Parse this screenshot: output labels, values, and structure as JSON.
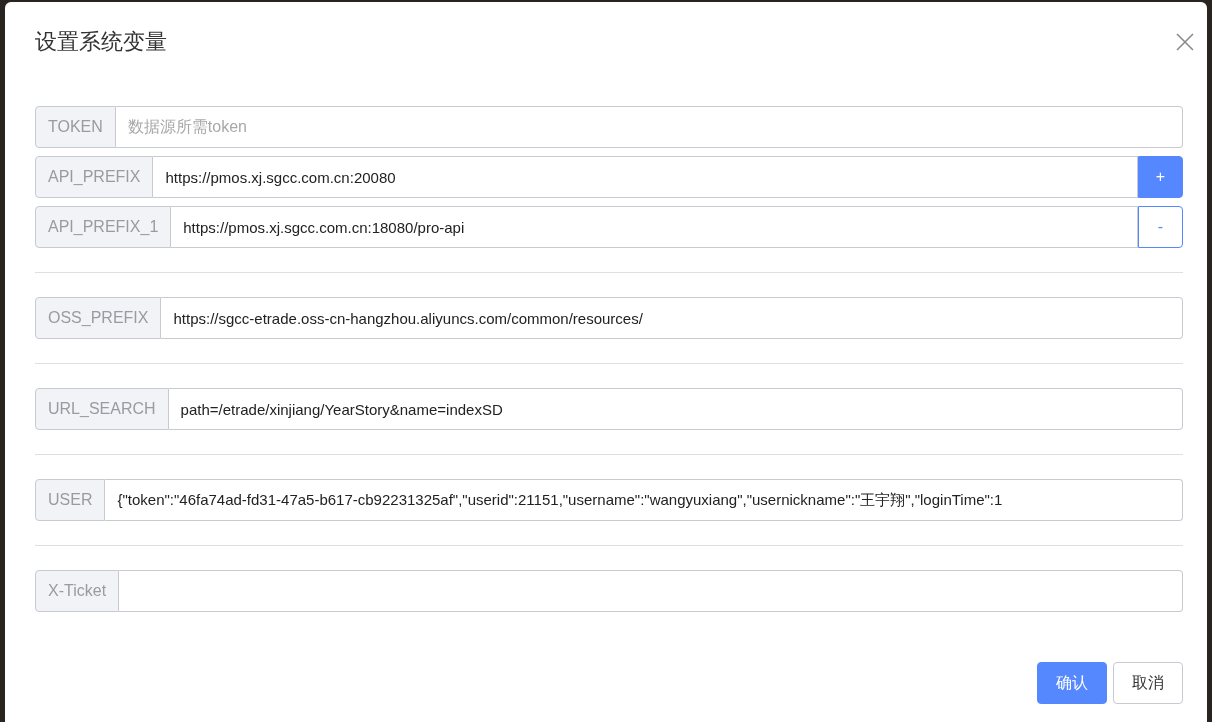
{
  "dialog": {
    "title": "设置系统变量",
    "groups": [
      {
        "fields": [
          {
            "label": "TOKEN",
            "placeholder": "数据源所需token"
          },
          {
            "label": "API_PREFIX",
            "value": "https://pmos.xj.sgcc.com.cn:20080",
            "button": {
              "kind": "add",
              "label": "+"
            }
          },
          {
            "label": "API_PREFIX_1",
            "value": "https://pmos.xj.sgcc.com.cn:18080/pro-api",
            "button": {
              "kind": "remove",
              "label": "-"
            }
          }
        ]
      },
      {
        "fields": [
          {
            "label": "OSS_PREFIX",
            "value": "https://sgcc-etrade.oss-cn-hangzhou.aliyuncs.com/common/resources/"
          }
        ]
      },
      {
        "fields": [
          {
            "label": "URL_SEARCH",
            "value": "path=/etrade/xinjiang/YearStory&name=indexSD"
          }
        ]
      },
      {
        "fields": [
          {
            "label": "USER",
            "value": "{\"token\":\"46fa74ad-fd31-47a5-b617-cb92231325af\",\"userid\":21151,\"username\":\"wangyuxiang\",\"usernickname\":\"王宇翔\",\"loginTime\":1"
          }
        ]
      },
      {
        "fields": [
          {
            "label": "X-Ticket"
          }
        ]
      }
    ],
    "buttons": [
      {
        "kind": "primary",
        "label": "确认"
      },
      {
        "kind": "default",
        "label": "取消"
      }
    ]
  }
}
